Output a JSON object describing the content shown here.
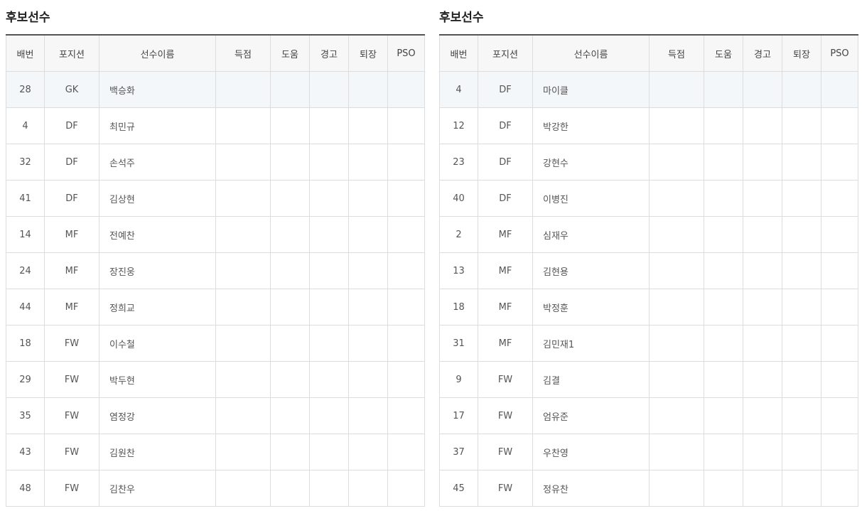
{
  "left": {
    "title": "후보선수",
    "headers": [
      "배번",
      "포지션",
      "선수이름",
      "득점",
      "도움",
      "경고",
      "퇴장",
      "PSO"
    ],
    "rows": [
      {
        "no": "28",
        "pos": "GK",
        "name": "백승화",
        "goals": "",
        "assists": "",
        "yellow": "",
        "red": "",
        "pso": ""
      },
      {
        "no": "4",
        "pos": "DF",
        "name": "최민규",
        "goals": "",
        "assists": "",
        "yellow": "",
        "red": "",
        "pso": ""
      },
      {
        "no": "32",
        "pos": "DF",
        "name": "손석주",
        "goals": "",
        "assists": "",
        "yellow": "",
        "red": "",
        "pso": ""
      },
      {
        "no": "41",
        "pos": "DF",
        "name": "김상현",
        "goals": "",
        "assists": "",
        "yellow": "",
        "red": "",
        "pso": ""
      },
      {
        "no": "14",
        "pos": "MF",
        "name": "전예찬",
        "goals": "",
        "assists": "",
        "yellow": "",
        "red": "",
        "pso": ""
      },
      {
        "no": "24",
        "pos": "MF",
        "name": "장진웅",
        "goals": "",
        "assists": "",
        "yellow": "",
        "red": "",
        "pso": ""
      },
      {
        "no": "44",
        "pos": "MF",
        "name": "정희교",
        "goals": "",
        "assists": "",
        "yellow": "",
        "red": "",
        "pso": ""
      },
      {
        "no": "18",
        "pos": "FW",
        "name": "이수철",
        "goals": "",
        "assists": "",
        "yellow": "",
        "red": "",
        "pso": ""
      },
      {
        "no": "29",
        "pos": "FW",
        "name": "박두현",
        "goals": "",
        "assists": "",
        "yellow": "",
        "red": "",
        "pso": ""
      },
      {
        "no": "35",
        "pos": "FW",
        "name": "염정강",
        "goals": "",
        "assists": "",
        "yellow": "",
        "red": "",
        "pso": ""
      },
      {
        "no": "43",
        "pos": "FW",
        "name": "김원찬",
        "goals": "",
        "assists": "",
        "yellow": "",
        "red": "",
        "pso": ""
      },
      {
        "no": "48",
        "pos": "FW",
        "name": "김찬우",
        "goals": "",
        "assists": "",
        "yellow": "",
        "red": "",
        "pso": ""
      }
    ]
  },
  "right": {
    "title": "후보선수",
    "headers": [
      "배번",
      "포지션",
      "선수이름",
      "득점",
      "도움",
      "경고",
      "퇴장",
      "PSO"
    ],
    "rows": [
      {
        "no": "4",
        "pos": "DF",
        "name": "마이클",
        "goals": "",
        "assists": "",
        "yellow": "",
        "red": "",
        "pso": ""
      },
      {
        "no": "12",
        "pos": "DF",
        "name": "박강한",
        "goals": "",
        "assists": "",
        "yellow": "",
        "red": "",
        "pso": ""
      },
      {
        "no": "23",
        "pos": "DF",
        "name": "강현수",
        "goals": "",
        "assists": "",
        "yellow": "",
        "red": "",
        "pso": ""
      },
      {
        "no": "40",
        "pos": "DF",
        "name": "이병진",
        "goals": "",
        "assists": "",
        "yellow": "",
        "red": "",
        "pso": ""
      },
      {
        "no": "2",
        "pos": "MF",
        "name": "심재우",
        "goals": "",
        "assists": "",
        "yellow": "",
        "red": "",
        "pso": ""
      },
      {
        "no": "13",
        "pos": "MF",
        "name": "김현용",
        "goals": "",
        "assists": "",
        "yellow": "",
        "red": "",
        "pso": ""
      },
      {
        "no": "18",
        "pos": "MF",
        "name": "박정훈",
        "goals": "",
        "assists": "",
        "yellow": "",
        "red": "",
        "pso": ""
      },
      {
        "no": "31",
        "pos": "MF",
        "name": "김민재1",
        "goals": "",
        "assists": "",
        "yellow": "",
        "red": "",
        "pso": ""
      },
      {
        "no": "9",
        "pos": "FW",
        "name": "김결",
        "goals": "",
        "assists": "",
        "yellow": "",
        "red": "",
        "pso": ""
      },
      {
        "no": "17",
        "pos": "FW",
        "name": "엄유준",
        "goals": "",
        "assists": "",
        "yellow": "",
        "red": "",
        "pso": ""
      },
      {
        "no": "37",
        "pos": "FW",
        "name": "우찬영",
        "goals": "",
        "assists": "",
        "yellow": "",
        "red": "",
        "pso": ""
      },
      {
        "no": "45",
        "pos": "FW",
        "name": "정유찬",
        "goals": "",
        "assists": "",
        "yellow": "",
        "red": "",
        "pso": ""
      }
    ]
  },
  "colors": {
    "header_bg": "#f7f7f7",
    "row_highlight_bg": "#f4f7fa",
    "border": "#dddddd",
    "top_rule": "#555555"
  }
}
